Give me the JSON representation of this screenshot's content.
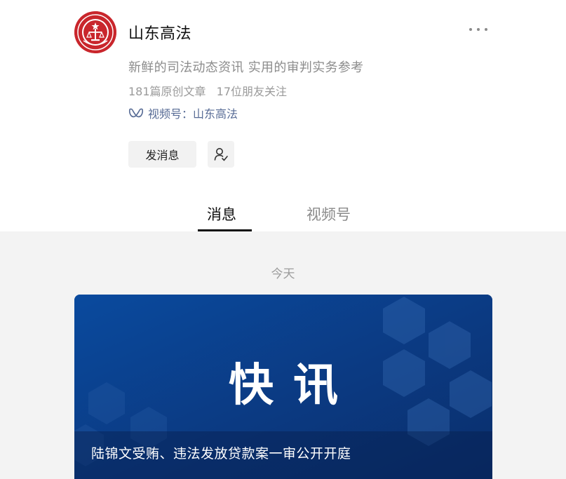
{
  "account": {
    "name": "山东高法",
    "description": "新鲜的司法动态资讯 实用的审判实务参考",
    "original_articles": "181篇原创文章",
    "friends_following": "17位朋友关注",
    "channel_link": "视频号：山东高法",
    "avatar_icon": "court-emblem-icon",
    "brand_color": "#c9262c"
  },
  "actions": {
    "send_message_label": "发消息",
    "follow_icon": "user-follow-icon",
    "more_icon": "more-dots-icon"
  },
  "tabs": [
    {
      "label": "消息",
      "active": true
    },
    {
      "label": "视频号",
      "active": false
    }
  ],
  "feed": {
    "date_label": "今天",
    "article": {
      "cover_headline": "快讯",
      "title": "陆锦文受贿、违法发放贷款案一审公开开庭",
      "cover_color": "#0d3d86"
    }
  },
  "colors": {
    "link": "#576b95",
    "muted_text": "#8c8c8c",
    "feed_background": "#f3f3f3"
  }
}
